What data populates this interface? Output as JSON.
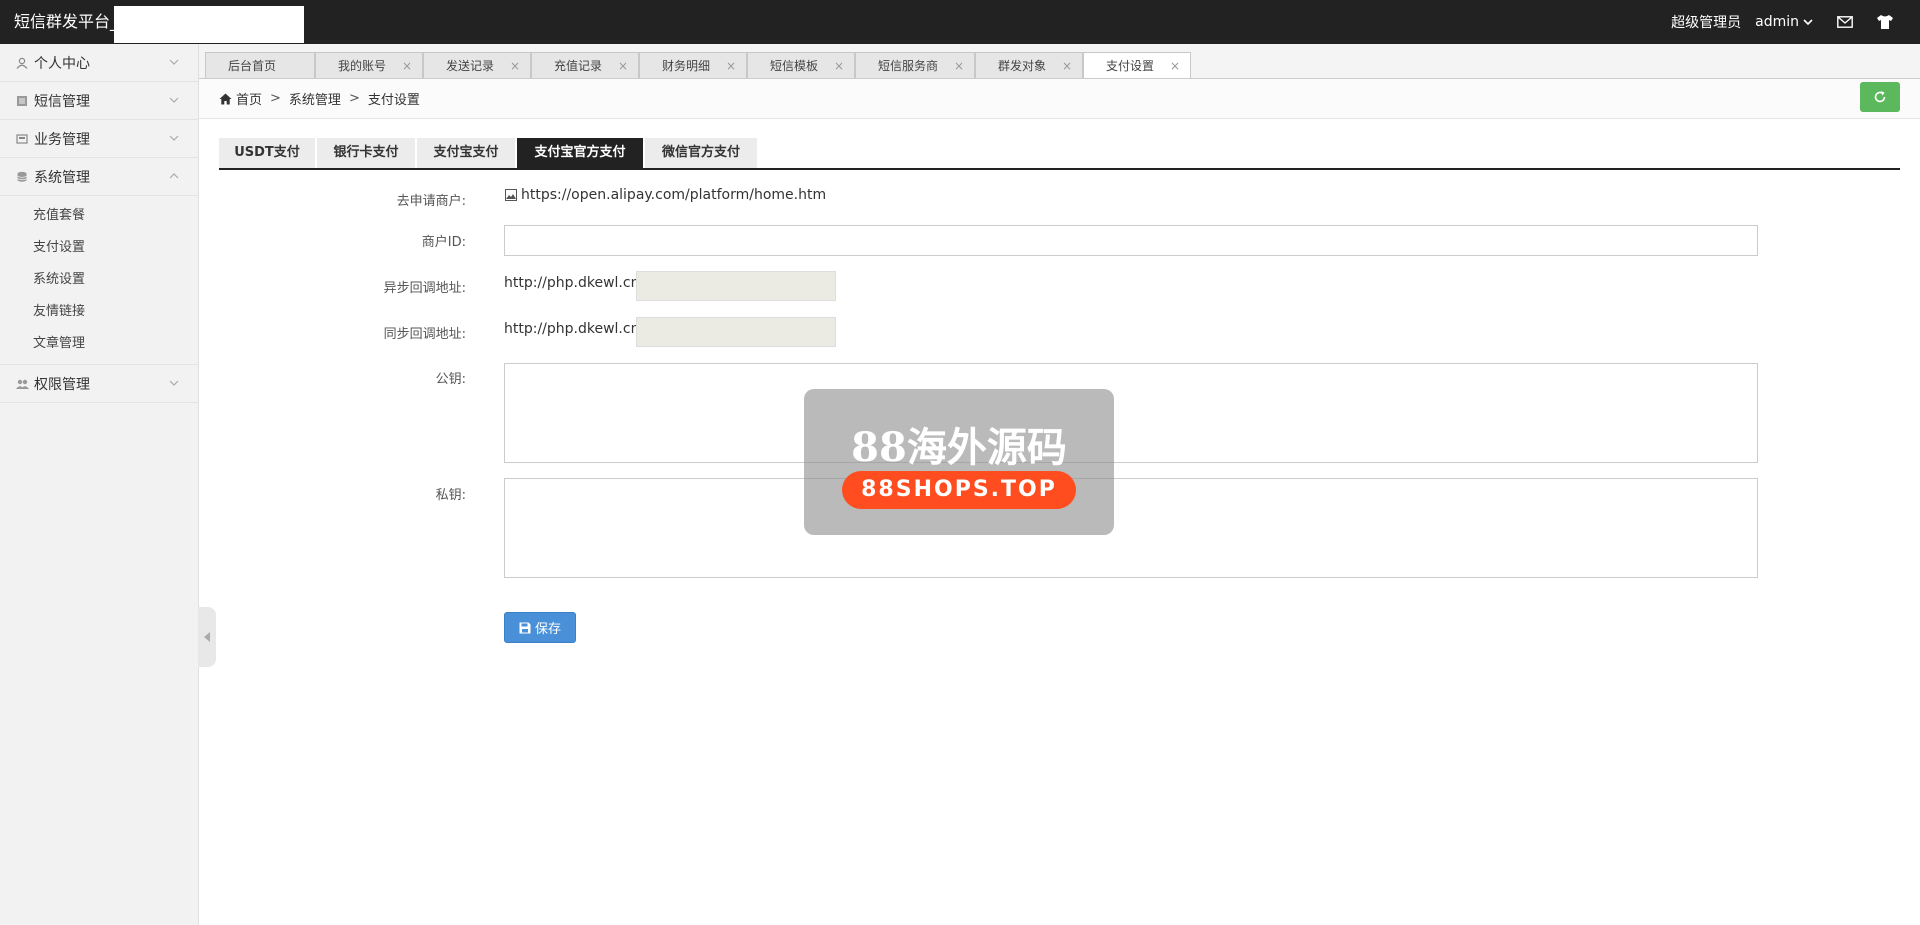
{
  "topbar": {
    "brand": "短信群发平台_",
    "role": "超级管理员",
    "user": "admin",
    "icons": [
      "chevron-down-icon",
      "mail-icon",
      "shirt-icon"
    ]
  },
  "sidebar": {
    "groups": [
      {
        "label": "个人中心",
        "icon": "user-icon"
      },
      {
        "label": "短信管理",
        "icon": "sms-icon"
      },
      {
        "label": "业务管理",
        "icon": "business-icon"
      },
      {
        "label": "系统管理",
        "icon": "database-icon",
        "expanded": true,
        "items": [
          "充值套餐",
          "支付设置",
          "系统设置",
          "友情链接",
          "文章管理"
        ]
      },
      {
        "label": "权限管理",
        "icon": "users-icon"
      }
    ]
  },
  "tabs": [
    {
      "label": "后台首页",
      "closable": false
    },
    {
      "label": "我的账号",
      "closable": true
    },
    {
      "label": "发送记录",
      "closable": true
    },
    {
      "label": "充值记录",
      "closable": true
    },
    {
      "label": "财务明细",
      "closable": true
    },
    {
      "label": "短信模板",
      "closable": true
    },
    {
      "label": "短信服务商",
      "closable": true
    },
    {
      "label": "群发对象",
      "closable": true
    },
    {
      "label": "支付设置",
      "closable": true,
      "active": true
    }
  ],
  "tab_close": "×",
  "breadcrumb": {
    "home": "首页",
    "sep": ">",
    "level1": "系统管理",
    "level2": "支付设置"
  },
  "paytabs": [
    "USDT支付",
    "银行卡支付",
    "支付宝支付",
    "支付宝官方支付",
    "微信官方支付"
  ],
  "form": {
    "apply_label": "去申请商户:",
    "apply_link": "https://open.alipay.com/platform/home.htm",
    "merchant_label": "商户ID:",
    "merchant_value": "",
    "async_label": "异步回调地址:",
    "async_prefix": "http://php.dkewl.cn",
    "sync_label": "同步回调地址:",
    "sync_prefix": "http://php.dkewl.cn",
    "public_key_label": "公钥:",
    "private_key_label": "私钥:",
    "save_label": "保存"
  },
  "watermark": {
    "line1": "88海外源码",
    "line2": "88SHOPS.TOP"
  },
  "colors": {
    "topbar": "#222222",
    "refresh": "#5cb85c",
    "save": "#4a90d9",
    "active_tab": "#222222"
  }
}
